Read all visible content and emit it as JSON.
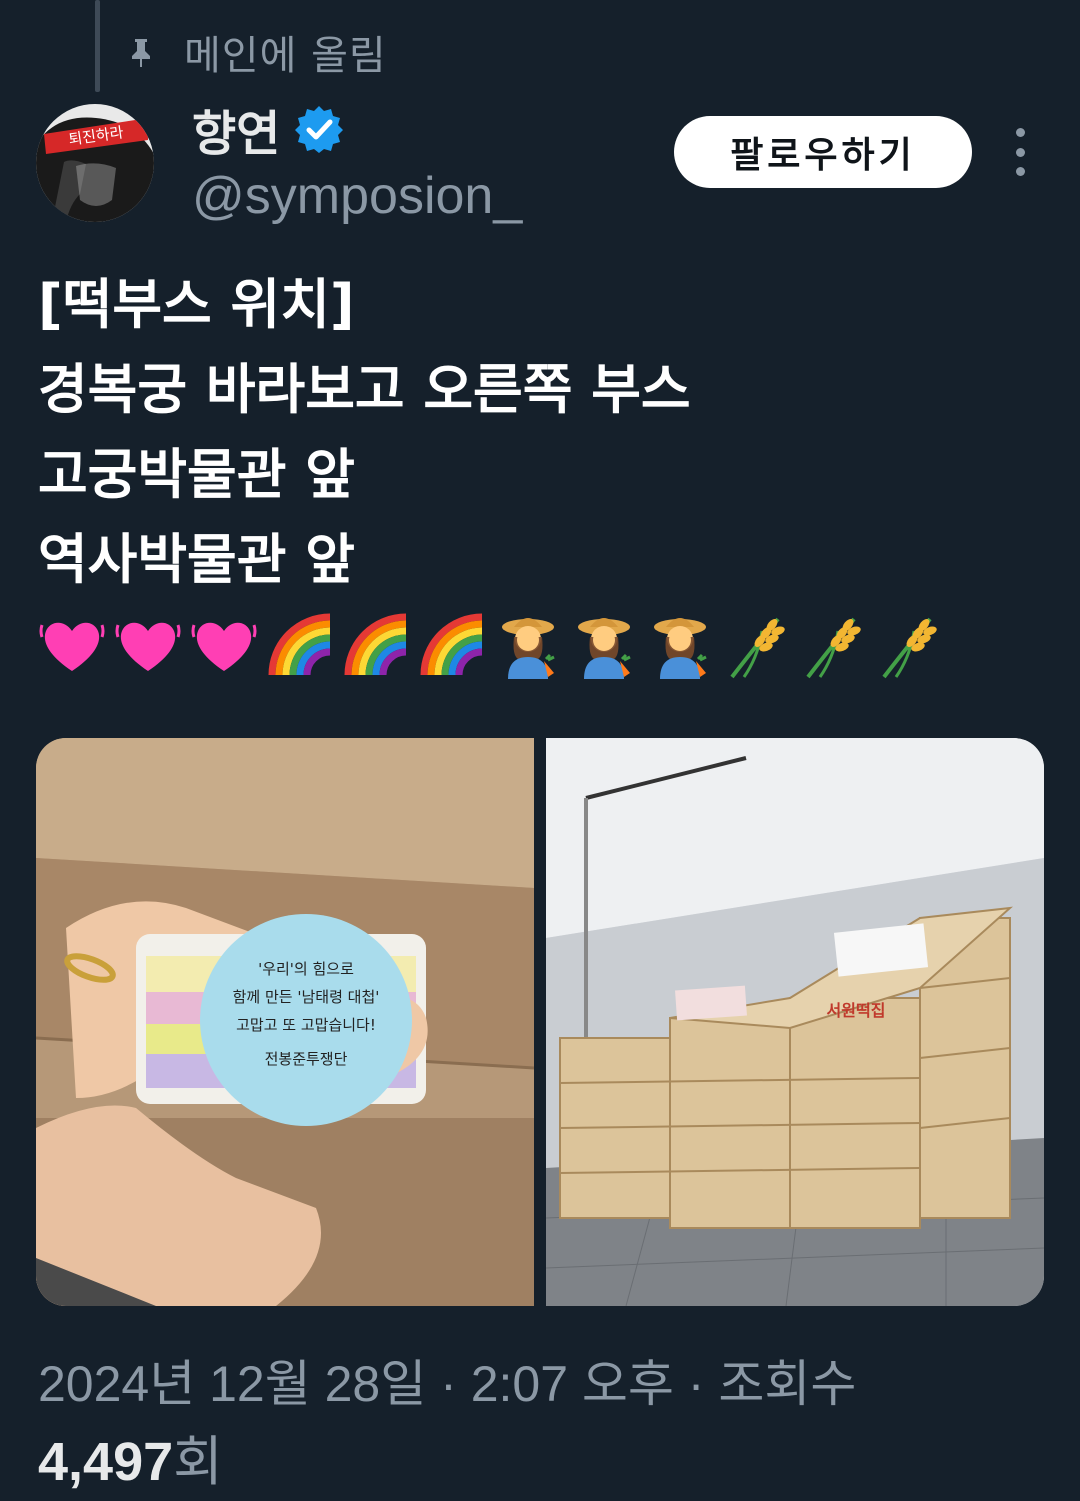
{
  "pinned": {
    "label": "메인에 올림",
    "icon": "pin-icon"
  },
  "author": {
    "display_name": "향연",
    "handle": "@symposion_",
    "verified": true,
    "avatar_headband_text": "퇴진하라",
    "verified_color": "#1d9bf0"
  },
  "actions": {
    "follow_label": "팔로우하기",
    "more_icon": "more-vertical-icon"
  },
  "tweet": {
    "lines": [
      "[떡부스 위치]",
      "경복궁 바라보고 오른쪽 부스",
      "고궁박물관 앞",
      "역사박물관 앞"
    ],
    "emojis": [
      "heart-icon",
      "heart-icon",
      "heart-icon",
      "rainbow-icon",
      "rainbow-icon",
      "rainbow-icon",
      "farmer-icon",
      "farmer-icon",
      "farmer-icon",
      "rice-icon",
      "rice-icon",
      "rice-icon"
    ]
  },
  "media": [
    {
      "name": "rice-cake-photo",
      "sticker_lines": [
        "'우리'의 힘으로",
        "함께 만든 '남태령 대첩'",
        "고맙고 또 고맙습니다!",
        "전봉준투쟁단"
      ]
    },
    {
      "name": "boxes-photo",
      "box_label": "서원떡집"
    }
  ],
  "meta": {
    "date": "2024년 12월 28일",
    "separator": " · ",
    "time": "2:07 오후",
    "views_label": "조회수",
    "views_count": "4,497",
    "views_suffix": "회"
  }
}
